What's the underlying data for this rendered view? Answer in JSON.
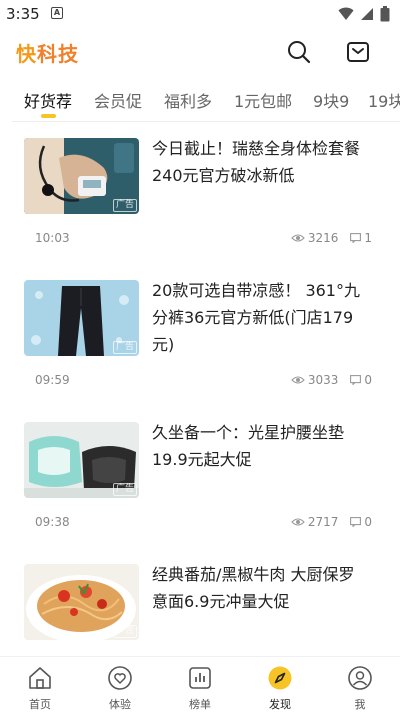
{
  "status": {
    "time": "3:35",
    "notif_glyph": "A"
  },
  "header": {
    "logo_part1": "快",
    "logo_part2": "科技"
  },
  "tabs": [
    {
      "label": "好货荐",
      "active": true
    },
    {
      "label": "会员促"
    },
    {
      "label": "福利多"
    },
    {
      "label": "1元包邮"
    },
    {
      "label": "9块9"
    },
    {
      "label": "19块"
    }
  ],
  "articles": [
    {
      "title": "今日截止！瑞慈全身体检套餐240元官方破冰新低",
      "time": "10:03",
      "views": "3216",
      "comments": "1",
      "ad_tag": "广告",
      "image": "blood-pressure-photo"
    },
    {
      "title": "20款可选自带凉感！ 361°九分裤36元官方新低(门店179元)",
      "time": "09:59",
      "views": "3033",
      "comments": "0",
      "ad_tag": "广告",
      "image": "pants-photo"
    },
    {
      "title": "久坐备一个：光星护腰坐垫19.9元起大促",
      "time": "09:38",
      "views": "2717",
      "comments": "0",
      "ad_tag": "广告",
      "image": "cushion-photo"
    },
    {
      "title": "经典番茄/黑椒牛肉 大厨保罗意面6.9元冲量大促",
      "time": "",
      "views": "",
      "comments": "",
      "ad_tag": "广告",
      "image": "pasta-photo"
    }
  ],
  "nav": [
    {
      "label": "首页",
      "icon": "home-icon"
    },
    {
      "label": "体验",
      "icon": "heart-icon"
    },
    {
      "label": "榜单",
      "icon": "chart-icon"
    },
    {
      "label": "发现",
      "icon": "compass-icon",
      "active": true
    },
    {
      "label": "我",
      "icon": "user-icon"
    }
  ],
  "colors": {
    "accent": "#f7c325",
    "logo": "#f39a1a"
  }
}
